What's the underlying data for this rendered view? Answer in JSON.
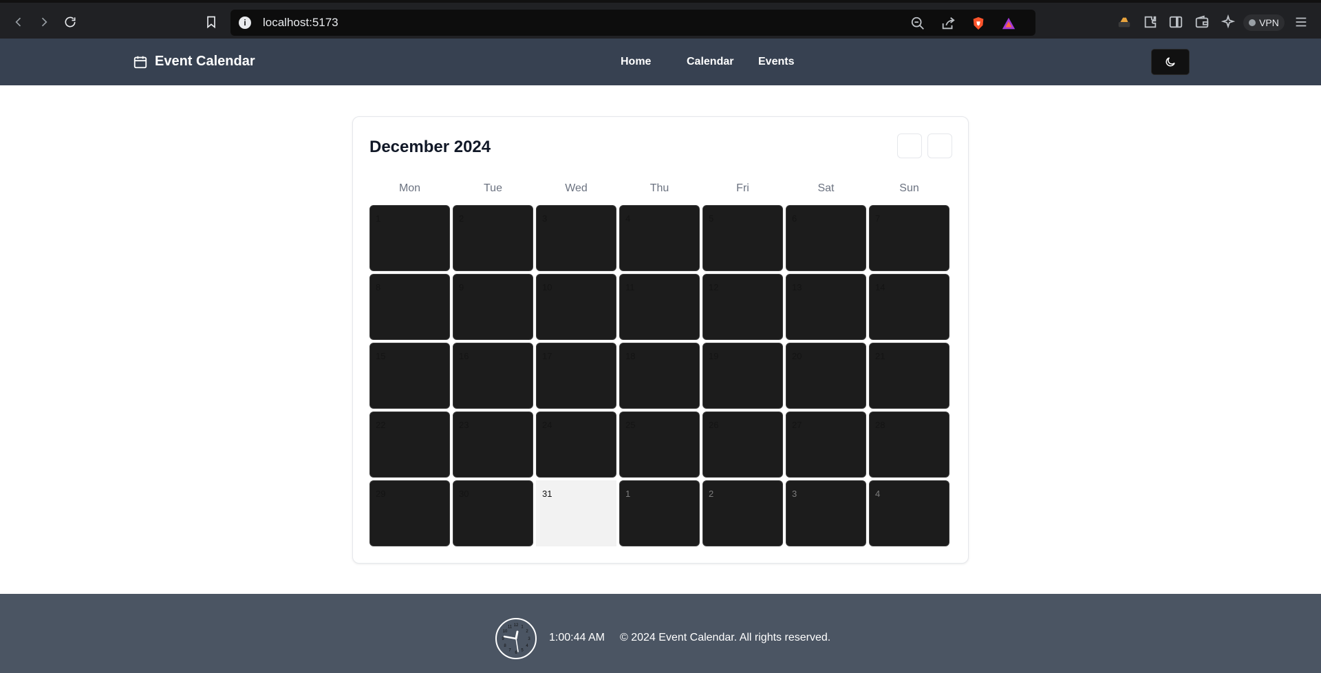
{
  "browser": {
    "url": "localhost:5173",
    "info_symbol": "i",
    "vpn_label": "VPN"
  },
  "header": {
    "brand": "Event Calendar",
    "nav": [
      "Home",
      "Calendar",
      "Events"
    ]
  },
  "calendar": {
    "title": "December 2024",
    "weekdays": [
      "Mon",
      "Tue",
      "Wed",
      "Thu",
      "Fri",
      "Sat",
      "Sun"
    ],
    "days": [
      "1",
      "2",
      "3",
      "4",
      "5",
      "6",
      "7",
      "8",
      "9",
      "10",
      "11",
      "12",
      "13",
      "14",
      "15",
      "16",
      "17",
      "18",
      "19",
      "20",
      "21",
      "22",
      "23",
      "24",
      "25",
      "26",
      "27",
      "28",
      "29",
      "30",
      "31",
      "1",
      "2",
      "3",
      "4"
    ]
  },
  "footer": {
    "time": "1:00:44 AM",
    "copyright": "© 2024 Event Calendar. All rights reserved.",
    "clock_numerals": [
      "12",
      "1",
      "2",
      "3",
      "4",
      "5",
      "6",
      "7",
      "8",
      "9",
      "10",
      "11"
    ]
  }
}
